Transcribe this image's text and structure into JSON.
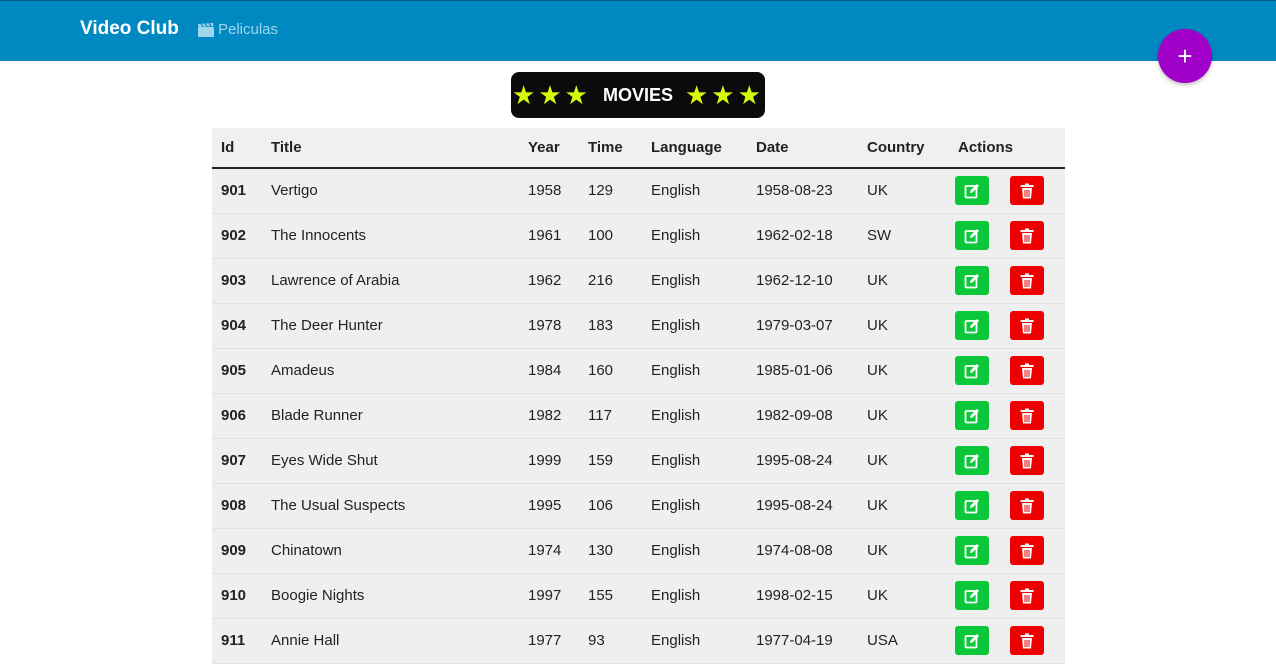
{
  "navbar": {
    "brand": "Video Club",
    "link_label": "Peliculas",
    "link_icon": "film-icon",
    "bg_color": "#0088c1"
  },
  "fab": {
    "label": "+",
    "color": "#a000c8"
  },
  "banner": {
    "stars_left": "★★★",
    "title": "MOVIES",
    "stars_right": "★★★",
    "star_color": "#d8f80a"
  },
  "table": {
    "headers": [
      "Id",
      "Title",
      "Year",
      "Time",
      "Language",
      "Date",
      "Country",
      "Actions"
    ],
    "rows": [
      [
        "901",
        "Vertigo",
        "1958",
        "129",
        "English",
        "1958-08-23",
        "UK"
      ],
      [
        "902",
        "The Innocents",
        "1961",
        "100",
        "English",
        "1962-02-18",
        "SW"
      ],
      [
        "903",
        "Lawrence of Arabia",
        "1962",
        "216",
        "English",
        "1962-12-10",
        "UK"
      ],
      [
        "904",
        "The Deer Hunter",
        "1978",
        "183",
        "English",
        "1979-03-07",
        "UK"
      ],
      [
        "905",
        "Amadeus",
        "1984",
        "160",
        "English",
        "1985-01-06",
        "UK"
      ],
      [
        "906",
        "Blade Runner",
        "1982",
        "117",
        "English",
        "1982-09-08",
        "UK"
      ],
      [
        "907",
        "Eyes Wide Shut",
        "1999",
        "159",
        "English",
        "1995-08-24",
        "UK"
      ],
      [
        "908",
        "The Usual Suspects",
        "1995",
        "106",
        "English",
        "1995-08-24",
        "UK"
      ],
      [
        "909",
        "Chinatown",
        "1974",
        "130",
        "English",
        "1974-08-08",
        "UK"
      ],
      [
        "910",
        "Boogie Nights",
        "1997",
        "155",
        "English",
        "1998-02-15",
        "UK"
      ],
      [
        "911",
        "Annie Hall",
        "1977",
        "93",
        "English",
        "1977-04-19",
        "USA"
      ]
    ],
    "edit_icon": "edit-icon",
    "delete_icon": "trash-icon",
    "edit_color": "#0ac839",
    "delete_color": "#ee0000"
  }
}
